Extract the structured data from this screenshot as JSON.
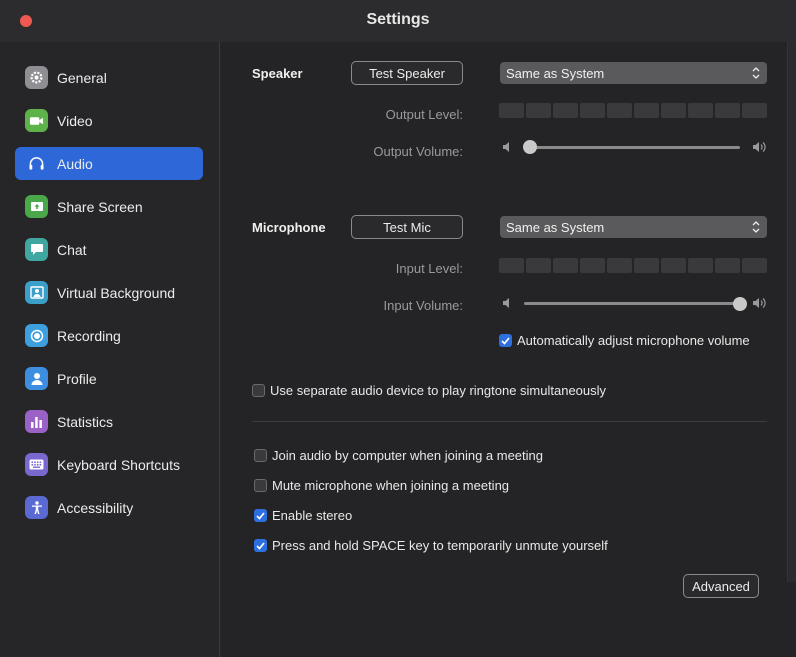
{
  "window": {
    "title": "Settings"
  },
  "sidebar": {
    "items": [
      {
        "label": "General",
        "icon": "gear-icon",
        "color": "#8e8e93",
        "active": false
      },
      {
        "label": "Video",
        "icon": "video-camera-icon",
        "color": "#5db34a",
        "active": false
      },
      {
        "label": "Audio",
        "icon": "headphones-icon",
        "color": "#2e68d8",
        "active": true
      },
      {
        "label": "Share Screen",
        "icon": "share-screen-icon",
        "color": "#4aa84a",
        "active": false
      },
      {
        "label": "Chat",
        "icon": "chat-bubble-icon",
        "color": "#3fa6a0",
        "active": false
      },
      {
        "label": "Virtual Background",
        "icon": "virtual-background-icon",
        "color": "#3aa0c9",
        "active": false
      },
      {
        "label": "Recording",
        "icon": "recording-icon",
        "color": "#3d9ee0",
        "active": false
      },
      {
        "label": "Profile",
        "icon": "profile-person-icon",
        "color": "#3d8ee0",
        "active": false
      },
      {
        "label": "Statistics",
        "icon": "bar-chart-icon",
        "color": "#9a62c7",
        "active": false
      },
      {
        "label": "Keyboard Shortcuts",
        "icon": "keyboard-icon",
        "color": "#7a68d0",
        "active": false
      },
      {
        "label": "Accessibility",
        "icon": "accessibility-person-icon",
        "color": "#5b6ad3",
        "active": false
      }
    ]
  },
  "speaker": {
    "section_label": "Speaker",
    "test_button": "Test Speaker",
    "device_selected": "Same as System",
    "output_level_label": "Output Level:",
    "output_volume_label": "Output Volume:",
    "output_volume": 0.03
  },
  "microphone": {
    "section_label": "Microphone",
    "test_button": "Test Mic",
    "device_selected": "Same as System",
    "input_level_label": "Input Level:",
    "input_volume_label": "Input Volume:",
    "input_volume": 1.0,
    "auto_adjust_label": "Automatically adjust microphone volume",
    "auto_adjust_checked": true
  },
  "options": {
    "separate_ringtone": {
      "label": "Use separate audio device to play ringtone simultaneously",
      "checked": false
    },
    "join_audio": {
      "label": "Join audio by computer when joining a meeting",
      "checked": false
    },
    "mute_mic": {
      "label": "Mute microphone when joining a meeting",
      "checked": false
    },
    "enable_stereo": {
      "label": "Enable stereo",
      "checked": true
    },
    "push_to_talk": {
      "label": "Press and hold SPACE key to temporarily unmute yourself",
      "checked": true
    }
  },
  "advanced_button": "Advanced",
  "colors": {
    "accent": "#2e68d8",
    "checkbox": "#2e6fe0",
    "close": "#ee5a52"
  }
}
